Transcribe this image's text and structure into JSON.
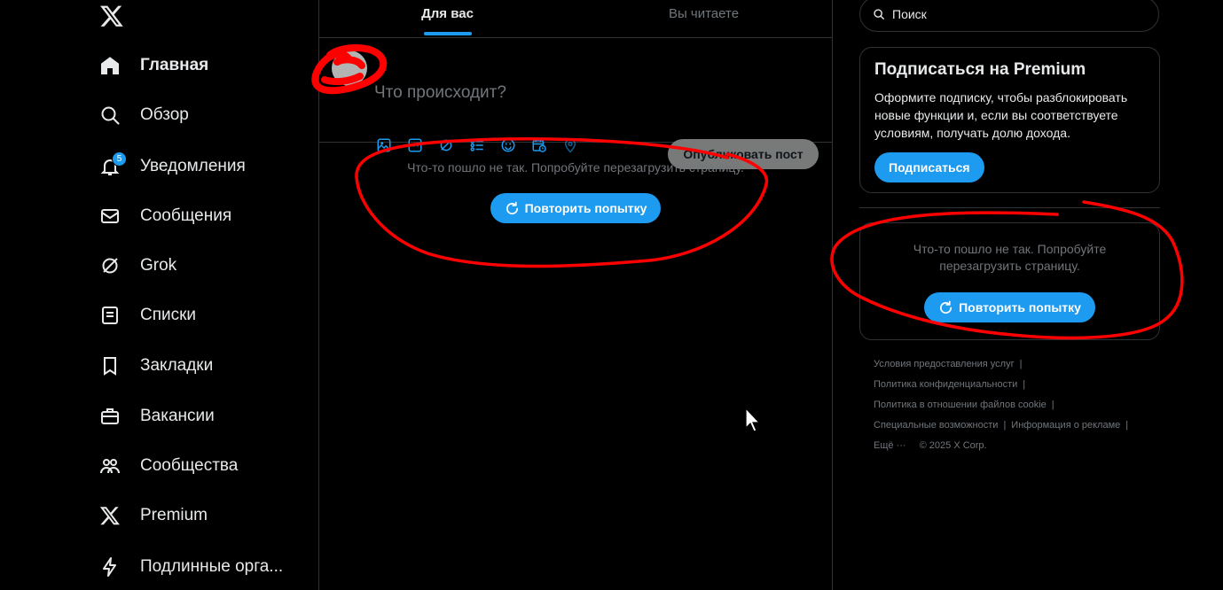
{
  "nav": {
    "items": [
      {
        "id": "home",
        "label": "Главная",
        "icon": "home-icon",
        "active": true
      },
      {
        "id": "explore",
        "label": "Обзор",
        "icon": "search-icon"
      },
      {
        "id": "notifications",
        "label": "Уведомления",
        "icon": "bell-icon",
        "badge": "5"
      },
      {
        "id": "messages",
        "label": "Сообщения",
        "icon": "envelope-icon"
      },
      {
        "id": "grok",
        "label": "Grok",
        "icon": "grok-icon"
      },
      {
        "id": "lists",
        "label": "Списки",
        "icon": "list-icon"
      },
      {
        "id": "bookmarks",
        "label": "Закладки",
        "icon": "bookmark-icon"
      },
      {
        "id": "jobs",
        "label": "Вакансии",
        "icon": "briefcase-icon"
      },
      {
        "id": "communities",
        "label": "Сообщества",
        "icon": "people-icon"
      },
      {
        "id": "premium",
        "label": "Premium",
        "icon": "x-logo-icon"
      },
      {
        "id": "verified-orgs",
        "label": "Подлинные орга...",
        "icon": "lightning-icon"
      }
    ]
  },
  "center": {
    "tabs": [
      {
        "label": "Для вас",
        "active": true
      },
      {
        "label": "Вы читаете",
        "active": false
      }
    ],
    "compose": {
      "placeholder": "Что происходит?",
      "post_label": "Опубликовать пост",
      "tools": [
        "media-icon",
        "gif-icon",
        "grok-icon",
        "poll-icon",
        "emoji-icon",
        "schedule-icon",
        "location-icon"
      ]
    },
    "error": {
      "text": "Что-то пошло не так. Попробуйте перезагрузить страницу.",
      "retry_label": "Повторить попытку"
    }
  },
  "right": {
    "search": {
      "placeholder": "Поиск"
    },
    "premium": {
      "title": "Подписаться на Premium",
      "text": "Оформите подписку, чтобы разблокировать новые функции и, если вы соответствуете условиям, получать долю дохода.",
      "button_label": "Подписаться"
    },
    "error": {
      "text": "Что-то пошло не так. Попробуйте перезагрузить страницу.",
      "retry_label": "Повторить попытку"
    },
    "footer": {
      "links": [
        "Условия предоставления услуг",
        "Политика конфиденциальности",
        "Политика в отношении файлов cookie",
        "Специальные возможности",
        "Информация о рекламе",
        "Ещё ···"
      ],
      "copyright": "© 2025 X Corp."
    }
  },
  "colors": {
    "accent": "#1d9bf0",
    "background": "#000000",
    "border": "#2f3336",
    "muted_text": "#71767b",
    "annotation": "#ff0000"
  }
}
